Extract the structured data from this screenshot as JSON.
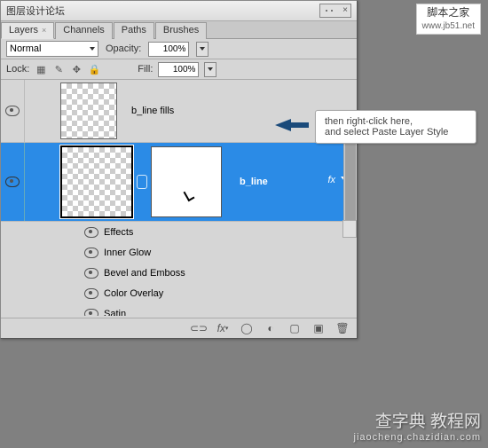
{
  "window": {
    "title": "图层设计论坛"
  },
  "tabs": [
    {
      "label": "Layers",
      "active": true
    },
    {
      "label": "Channels",
      "active": false
    },
    {
      "label": "Paths",
      "active": false
    },
    {
      "label": "Brushes",
      "active": false
    }
  ],
  "controls": {
    "blend_mode": "Normal",
    "opacity_label": "Opacity:",
    "opacity_value": "100%",
    "lock_label": "Lock:",
    "fill_label": "Fill:",
    "fill_value": "100%"
  },
  "layers": [
    {
      "name": "b_line fills",
      "visible": true,
      "selected": false
    },
    {
      "name": "b_line",
      "visible": true,
      "selected": true,
      "has_fx": true,
      "fx_label": "fx"
    }
  ],
  "effects": {
    "header": "Effects",
    "items": [
      "Inner Glow",
      "Bevel and Emboss",
      "Color Overlay",
      "Satin"
    ]
  },
  "bottom_icons": [
    "link",
    "fx",
    "mask",
    "adjust",
    "group",
    "new",
    "trash"
  ],
  "callout": {
    "line1": "then right-click here,",
    "line2": "and select Paste Layer Style"
  },
  "watermark_top": {
    "line1": "脚本之家",
    "line2": "www.jb51.net"
  },
  "watermark_bottom": {
    "line1": "查字典 教程网",
    "line2": "jiaocheng.chazidian.com"
  }
}
